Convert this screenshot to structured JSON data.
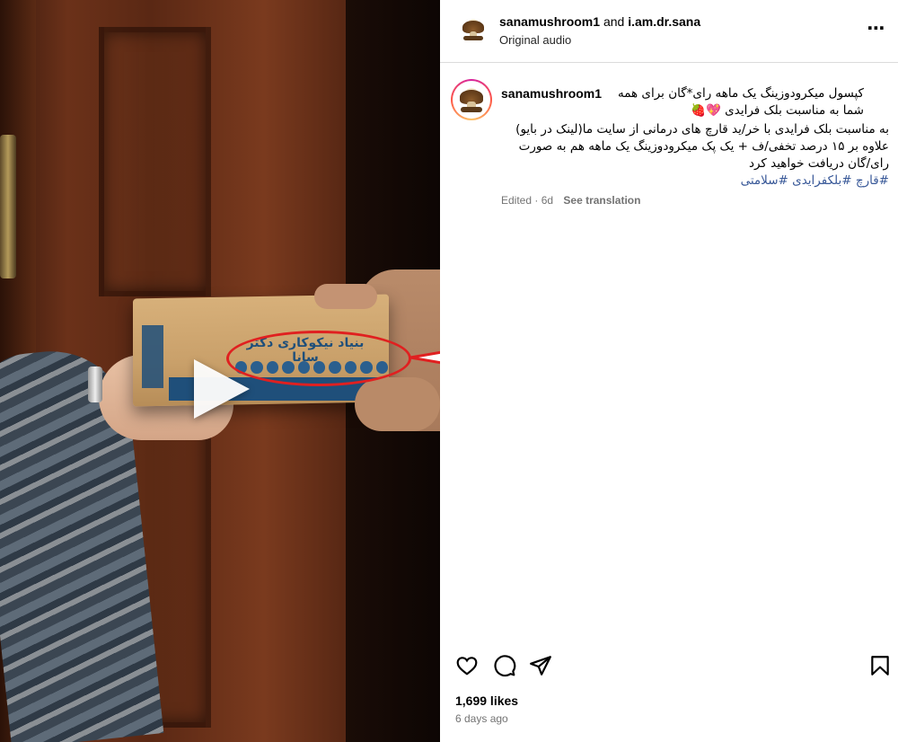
{
  "header": {
    "username": "sanamushroom1",
    "connector": "and",
    "collaborator": "i.am.dr.sana",
    "audio": "Original audio",
    "more_icon": "more-horizontal-icon"
  },
  "caption": {
    "username": "sanamushroom1",
    "line1": "کپسول میکرودوزینگ یک ماهه رای*گان برای همه",
    "line2": "شما به مناسبت بلک فرایدی",
    "line2_emojis": "💖🍓",
    "line3": "به مناسبت بلک فرایدی با خر/ید قارچ های درمانی از سایت ما(لینک در بایو)",
    "line4": "علاوه بر ۱۵ درصد تخفی/ف + یک پک میکرودوزینگ یک ماهه هم به صورت",
    "line5": "رای/گان دریافت خواهید کرد",
    "tags": [
      "#قارچ",
      "#بلکفرایدی",
      "#سلامتی"
    ],
    "edited": "Edited",
    "age": "6d",
    "see_translation": "See translation"
  },
  "media": {
    "box_brand": "بنیاد نیکوکاری دکتر سانا",
    "play_icon": "play-icon"
  },
  "actions": {
    "like_icon": "heart-icon",
    "comment_icon": "comment-icon",
    "share_icon": "share-icon",
    "save_icon": "bookmark-icon"
  },
  "likes": "1,699 likes",
  "posted": "6 days ago",
  "colors": {
    "annotation_red": "#e02020",
    "hashtag_blue": "#385898",
    "muted_text": "#737373",
    "divider": "#dbdbdb"
  }
}
